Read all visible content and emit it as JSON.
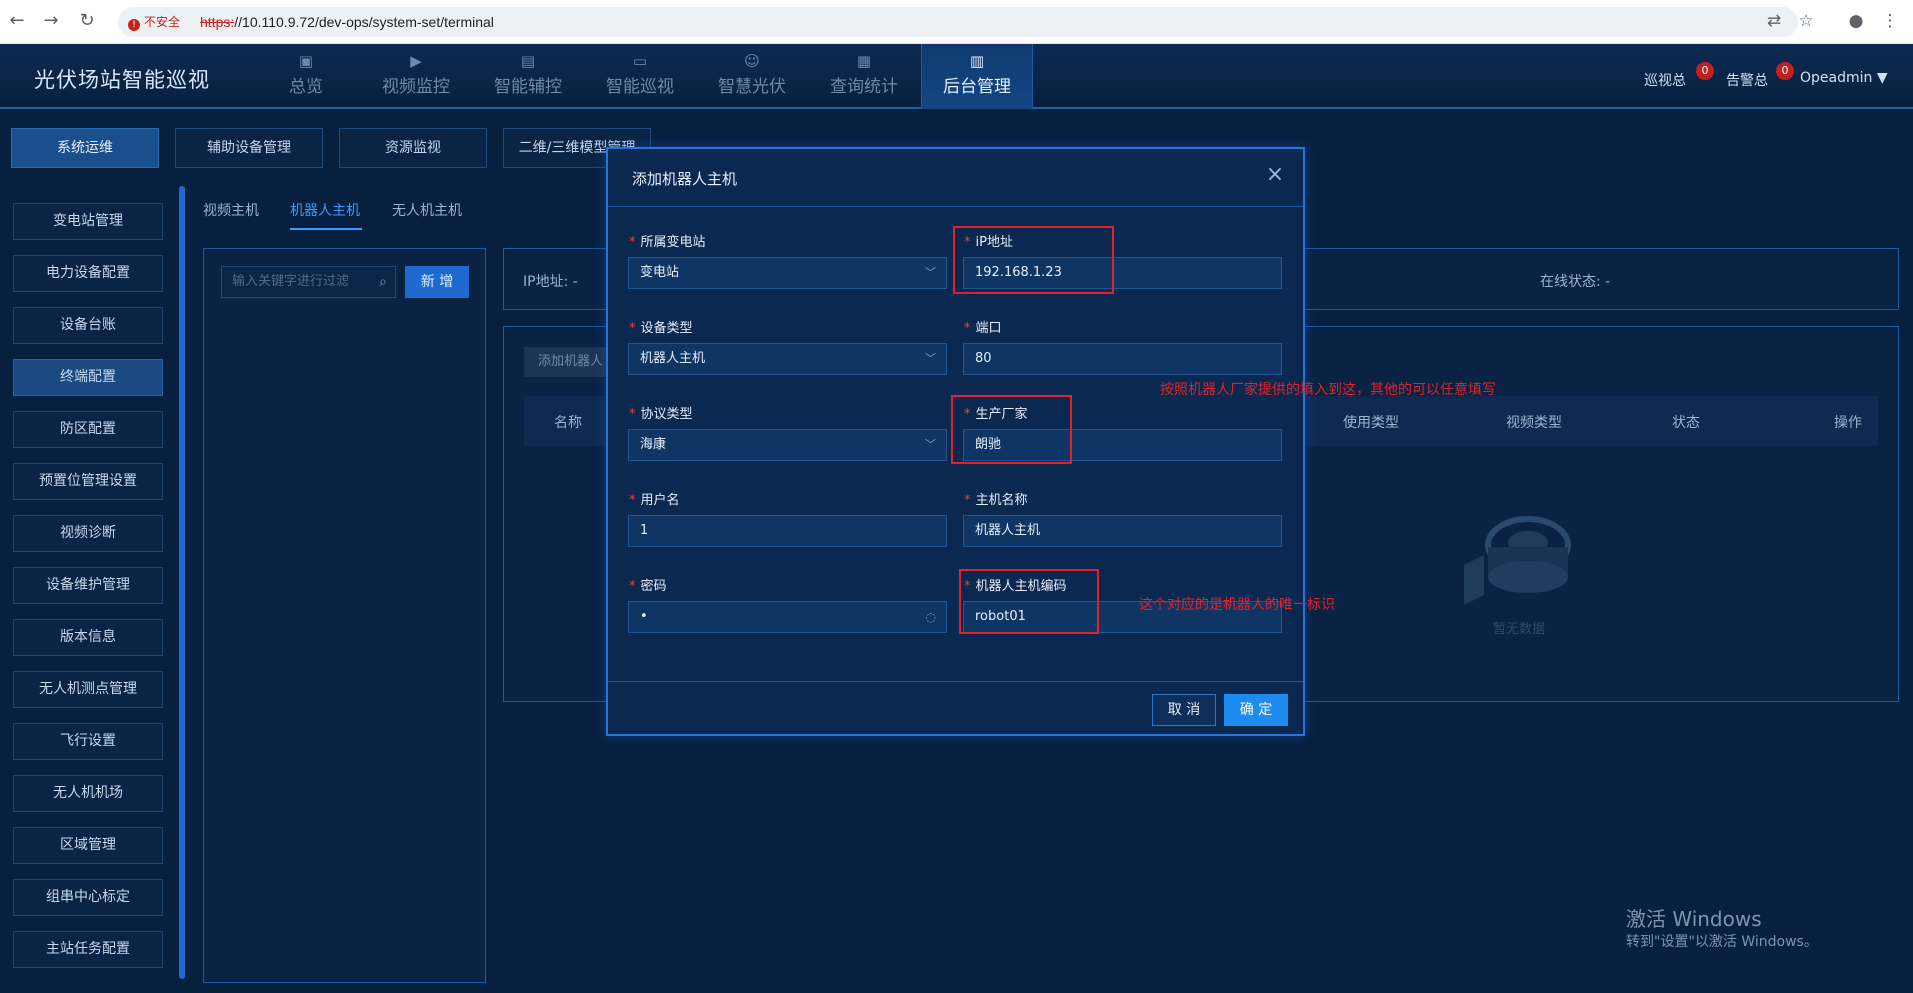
{
  "browser": {
    "insecure_label": "不安全",
    "url_scheme": "https:",
    "url_rest": "//10.110.9.72/dev-ops/system-set/terminal"
  },
  "header": {
    "app_title": "光伏场站智能巡视",
    "nav": [
      {
        "label": "总览",
        "icon": "dashboard-icon"
      },
      {
        "label": "视频监控",
        "icon": "video-icon"
      },
      {
        "label": "智能辅控",
        "icon": "control-icon"
      },
      {
        "label": "智能巡视",
        "icon": "monitor-icon"
      },
      {
        "label": "智慧光伏",
        "icon": "user-icon"
      },
      {
        "label": "查询统计",
        "icon": "report-icon"
      },
      {
        "label": "后台管理",
        "icon": "book-icon"
      }
    ],
    "patrol_label": "巡视总",
    "patrol_count": "0",
    "alarm_label": "告警总",
    "alarm_count": "0",
    "user": "Opeadmin"
  },
  "subtabs": [
    "系统运维",
    "辅助设备管理",
    "资源监视",
    "二维/三维模型管理"
  ],
  "sidebar": [
    "变电站管理",
    "电力设备配置",
    "设备台账",
    "终端配置",
    "防区配置",
    "预置位管理设置",
    "视频诊断",
    "设备维护管理",
    "版本信息",
    "无人机测点管理",
    "飞行设置",
    "无人机机场",
    "区域管理",
    "组串中心标定",
    "主站任务配置"
  ],
  "inner_tabs": [
    "视频主机",
    "机器人主机",
    "无人机主机"
  ],
  "main": {
    "search_placeholder": "输入关键字进行过滤",
    "add_label": "新 增",
    "ip_label": "IP地址: -",
    "online_label": "在线状态: -",
    "add_robot_btn": "添加机器人",
    "col_name": "名称",
    "col_use": "使用类型",
    "col_video": "视频类型",
    "col_status": "状态",
    "col_op": "操作",
    "empty": "暂无数据"
  },
  "modal": {
    "title": "添加机器人主机",
    "station_label": "所属变电站",
    "station_value": "变电站",
    "ip_label": "iP地址",
    "ip_value": "192.168.1.23",
    "device_type_label": "设备类型",
    "device_type_value": "机器人主机",
    "port_label": "端口",
    "port_value": "80",
    "protocol_label": "协议类型",
    "protocol_value": "海康",
    "vendor_label": "生产厂家",
    "vendor_value": "朗驰",
    "username_label": "用户名",
    "username_value": "1",
    "hostname_label": "主机名称",
    "hostname_value": "机器人主机",
    "password_label": "密码",
    "password_value": "•",
    "code_label": "机器人主机编码",
    "code_value": "robot01",
    "cancel": "取 消",
    "ok": "确 定"
  },
  "annotations": {
    "note1": "按照机器人厂家提供的填入到这，其他的可以任意填写",
    "note2": "这个对应的是机器人的唯一标识"
  },
  "watermark": {
    "line1": "激活 Windows",
    "line2": "转到\"设置\"以激活 Windows。"
  }
}
